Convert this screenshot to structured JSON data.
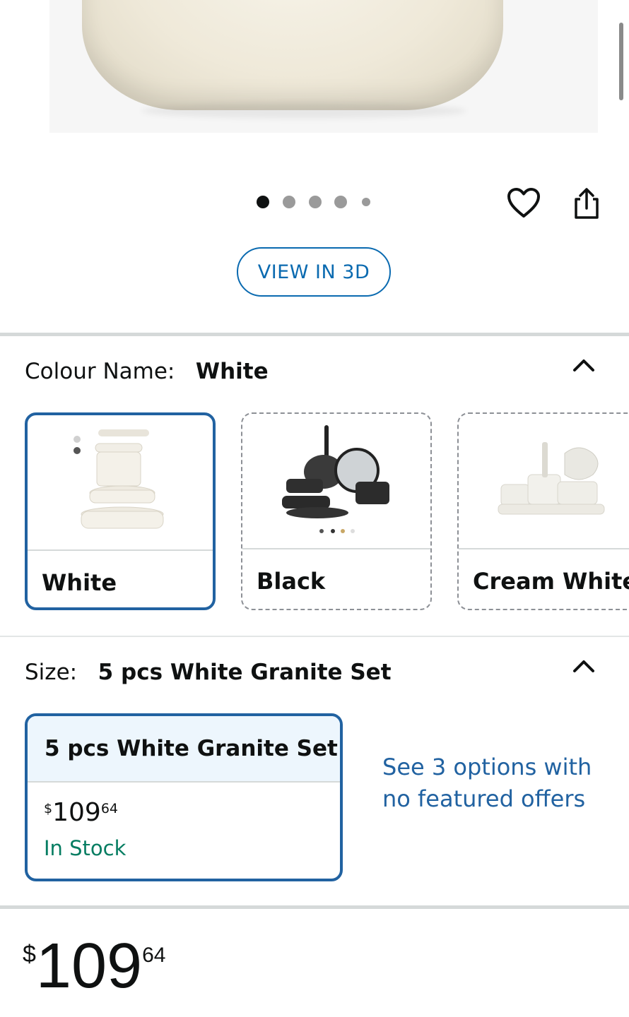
{
  "carousel": {
    "dot_count": 5,
    "active_index": 0
  },
  "actions": {
    "wishlist_icon": "heart-outline-icon",
    "share_icon": "share-icon"
  },
  "view3d_label": "VIEW IN 3D",
  "colour": {
    "label": "Colour Name:",
    "selected": "White",
    "options": [
      {
        "name": "White",
        "selected": true
      },
      {
        "name": "Black",
        "selected": false
      },
      {
        "name": "Cream White",
        "selected": false
      }
    ]
  },
  "size": {
    "label": "Size:",
    "selected": "5 pcs White Granite Set",
    "card": {
      "title": "5 pcs White Granite Set",
      "currency": "$",
      "price_whole": "109",
      "price_fraction": "64",
      "stock": "In Stock"
    },
    "see_options": "See 3 options with no featured offers"
  },
  "price": {
    "currency": "$",
    "whole": "109",
    "fraction": "64"
  },
  "colors": {
    "link_blue": "#2162a1",
    "in_stock_green": "#067d62",
    "selected_border": "#2162a1"
  }
}
